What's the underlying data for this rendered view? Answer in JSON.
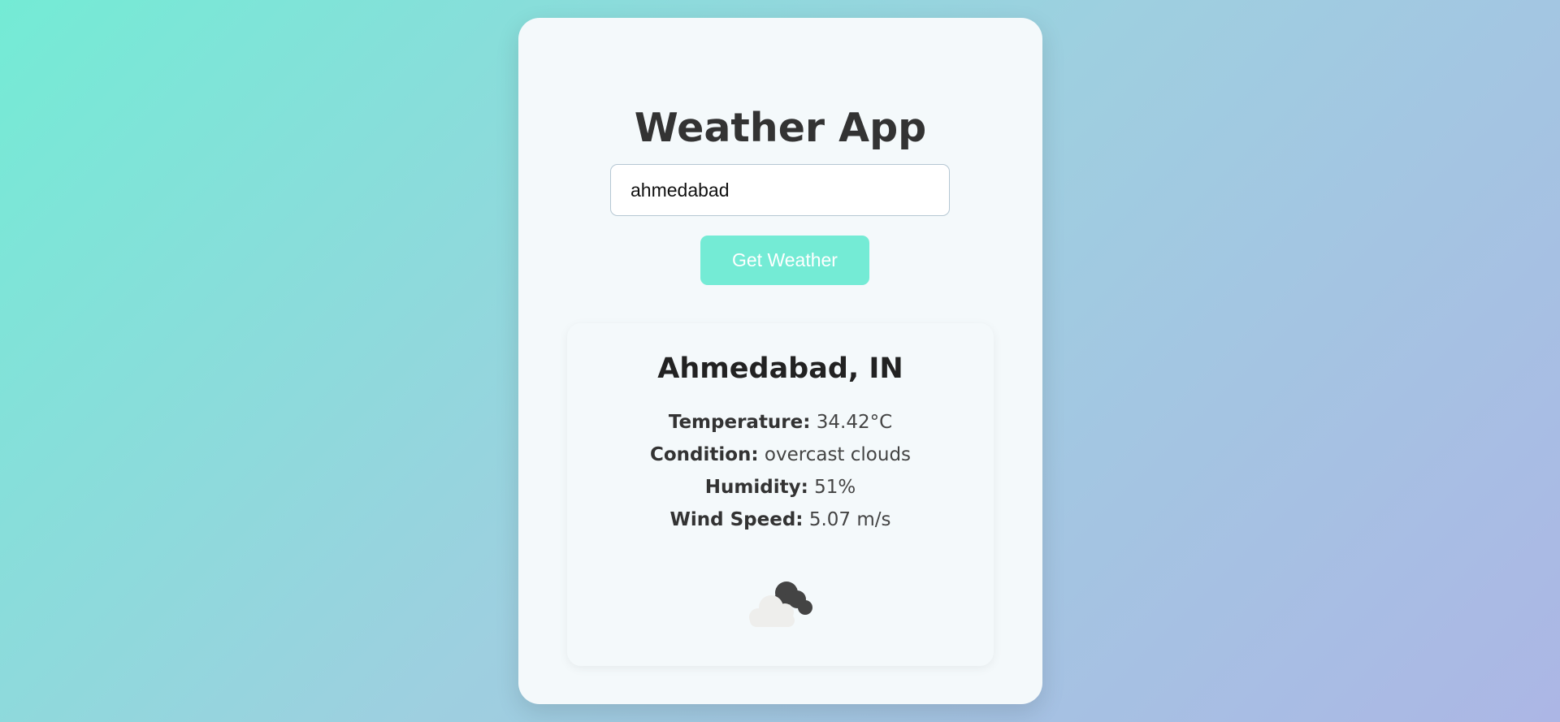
{
  "app": {
    "title": "Weather App"
  },
  "search": {
    "value": "ahmedabad",
    "button_label": "Get Weather"
  },
  "result": {
    "city": "Ahmedabad, IN",
    "temperature_label": "Temperature:",
    "temperature_value": "34.42°C",
    "condition_label": "Condition:",
    "condition_value": "overcast clouds",
    "humidity_label": "Humidity:",
    "humidity_value": "51%",
    "wind_label": "Wind Speed:",
    "wind_value": "5.07 m/s",
    "icon": "overcast-clouds-icon"
  },
  "colors": {
    "accent": "#74ebd5",
    "background_start": "#74ebd5",
    "background_end": "#acb6e5",
    "card": "#f4f9fb"
  }
}
